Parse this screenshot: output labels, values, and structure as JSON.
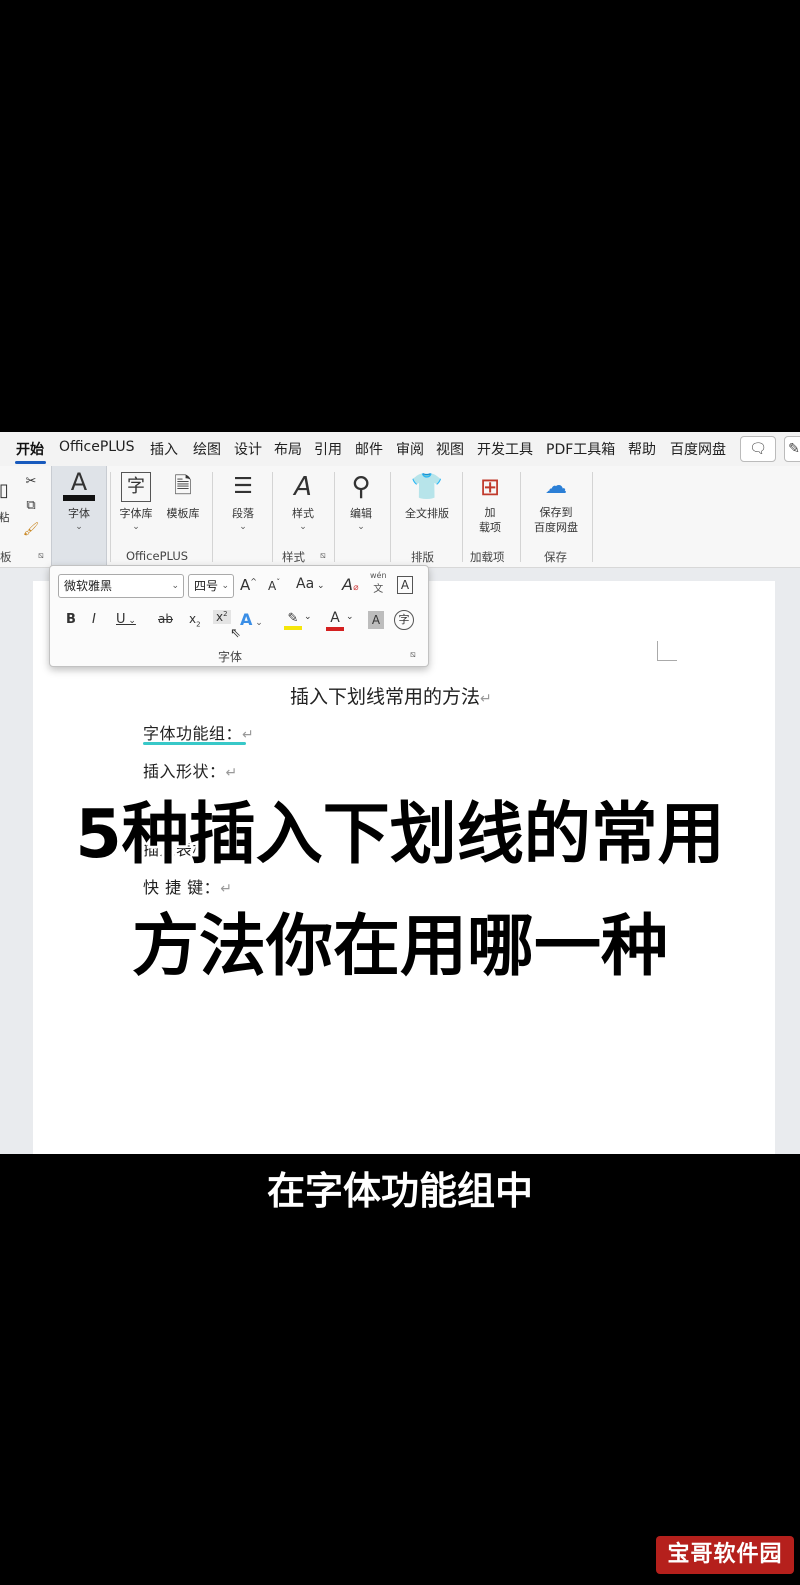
{
  "menu": {
    "tabs": [
      "开始",
      "OfficePLUS",
      "插入",
      "绘图",
      "设计",
      "布局",
      "引用",
      "邮件",
      "审阅",
      "视图",
      "开发工具",
      "PDF工具箱",
      "帮助",
      "百度网盘"
    ],
    "active_tab": "开始"
  },
  "ribbon": {
    "clipboard": {
      "paste_label": "粘",
      "group_label": "板"
    },
    "font_button": {
      "label": "字体"
    },
    "officeplus": {
      "font_lib": "字体库",
      "template_lib": "模板库",
      "group_label": "OfficePLUS"
    },
    "paragraph": {
      "label": "段落"
    },
    "styles": {
      "label": "样式",
      "group_label": "样式"
    },
    "editing": {
      "label": "编辑"
    },
    "layout": {
      "label": "全文排版",
      "group_label": "排版"
    },
    "addins": {
      "label_line1": "加",
      "label_line2": "载项",
      "group_label": "加载项"
    },
    "save": {
      "label_line1": "保存到",
      "label_line2": "百度网盘",
      "group_label": "保存"
    }
  },
  "font_popup": {
    "font_name": "微软雅黑",
    "font_size": "四号",
    "group_label": "字体",
    "buttons": {
      "grow": "A",
      "shrink": "A",
      "case": "Aa",
      "clear": "A",
      "phonetic": "wén",
      "border": "A",
      "bold": "B",
      "italic": "I",
      "underline": "U",
      "strike": "ab",
      "subscript": "x",
      "superscript": "x",
      "effects": "A",
      "font_color": "A",
      "shading": "A",
      "enclose": "字"
    }
  },
  "document": {
    "title": "插入下划线常用的方法",
    "lines": [
      "字体功能组：",
      "插入形状：",
      "插入表格：",
      "快 捷 键："
    ]
  },
  "overlay": {
    "headline_line1": "5种插入下划线的常用",
    "headline_line2": "方法你在用哪一种",
    "subtitle": "在字体功能组中"
  },
  "watermark": "宝哥软件园",
  "colors": {
    "accent": "#185abd",
    "underline_highlight": "#38c8c8",
    "watermark_bg": "#b5201c",
    "highlight_yellow": "#f5e60a",
    "font_color_red": "#d42020"
  }
}
